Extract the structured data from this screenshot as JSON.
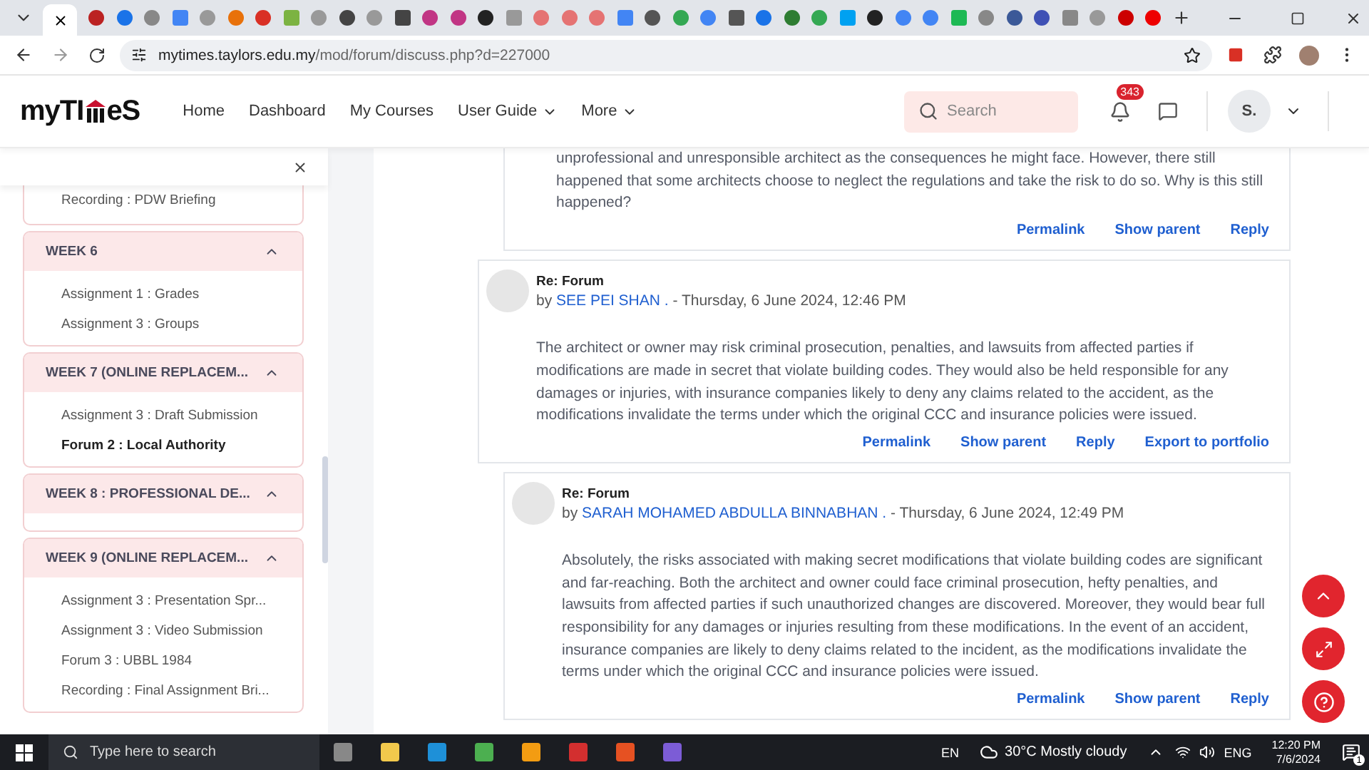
{
  "browser": {
    "url_host": "mytimes.taylors.edu.my",
    "url_path": "/mod/forum/discuss.php?d=227000"
  },
  "site_header": {
    "logo": {
      "left": "myTI",
      "right": "eS"
    },
    "nav": [
      {
        "label": "Home",
        "dropdown": false
      },
      {
        "label": "Dashboard",
        "dropdown": false
      },
      {
        "label": "My Courses",
        "dropdown": false
      },
      {
        "label": "User Guide",
        "dropdown": true
      },
      {
        "label": "More",
        "dropdown": true
      }
    ],
    "search": {
      "placeholder": "Search"
    },
    "notifications": {
      "count": "343"
    },
    "user": {
      "initials": "S."
    }
  },
  "course_index": {
    "sections": [
      {
        "kind": "continued",
        "items": [
          {
            "label": "Recording : PDW Briefing",
            "selected": false
          }
        ]
      },
      {
        "kind": "section",
        "title": "WEEK 6",
        "expanded": true,
        "items": [
          {
            "label": "Assignment 1 : Grades",
            "selected": false
          },
          {
            "label": "Assignment 3 : Groups",
            "selected": false
          }
        ]
      },
      {
        "kind": "section",
        "title": "WEEK 7 (ONLINE REPLACEM...",
        "expanded": true,
        "items": [
          {
            "label": "Assignment 3 : Draft Submission",
            "selected": false
          },
          {
            "label": "Forum 2 : Local Authority",
            "selected": true
          }
        ]
      },
      {
        "kind": "section",
        "title": "WEEK 8 : PROFESSIONAL DE...",
        "expanded": true
      },
      {
        "kind": "section",
        "title": "WEEK 9 (ONLINE REPLACEM...",
        "expanded": true,
        "items": [
          {
            "label": "Assignment 3 : Presentation Spr...",
            "selected": false
          },
          {
            "label": "Assignment 3 : Video Submission",
            "selected": false
          },
          {
            "label": "Forum 3 : UBBL 1984",
            "selected": false
          },
          {
            "label": "Recording : Final Assignment Bri...",
            "selected": false
          }
        ]
      }
    ]
  },
  "posts": [
    {
      "kind": "offscreen",
      "children": [
        {
          "kind": "cut",
          "body": "unprofessional and unresponsible architect as the consequences he might face. However, there still happened that some architects choose to neglect the regulations and take the risk to do so. Why is this still happened?",
          "actions": [
            "Permalink",
            "Show parent",
            "Reply"
          ]
        }
      ]
    },
    {
      "kind": "post",
      "subject": "Re: Forum",
      "by": "by",
      "author": "SEE PEI SHAN .",
      "date": "- Thursday, 6 June 2024, 12:46 PM",
      "body": "The architect or owner may risk criminal prosecution, penalties, and lawsuits from affected parties if modifications are made in secret that violate building codes. They would also be held responsible for any damages or injuries, with insurance companies likely to deny any claims related to the accident, as the modifications invalidate the terms under which the original CCC and insurance policies were issued.",
      "actions": [
        "Permalink",
        "Show parent",
        "Reply",
        "Export to portfolio"
      ],
      "children": [
        {
          "kind": "post",
          "subject": "Re: Forum",
          "by": "by",
          "author": "SARAH MOHAMED ABDULLA BINNABHAN .",
          "date": "- Thursday, 6 June 2024, 12:49 PM",
          "body": "Absolutely, the risks associated with making secret modifications that violate building codes are significant and far-reaching. Both the architect and owner could face criminal prosecution, hefty penalties, and lawsuits from affected parties if such unauthorized changes are discovered. Moreover, they would bear full responsibility for any damages or injuries resulting from these modifications. In the event of an accident, insurance companies are likely to deny claims related to the incident, as the modifications invalidate the terms under which the original CCC and insurance policies were issued.",
          "actions": [
            "Permalink",
            "Show parent",
            "Reply"
          ]
        }
      ]
    }
  ],
  "taskbar": {
    "search_placeholder": "Type here to search",
    "language": "EN",
    "weather": "30°C  Mostly cloudy",
    "input": "ENG",
    "time": "12:20 PM",
    "date": "7/6/2024",
    "notification_count": "1"
  }
}
